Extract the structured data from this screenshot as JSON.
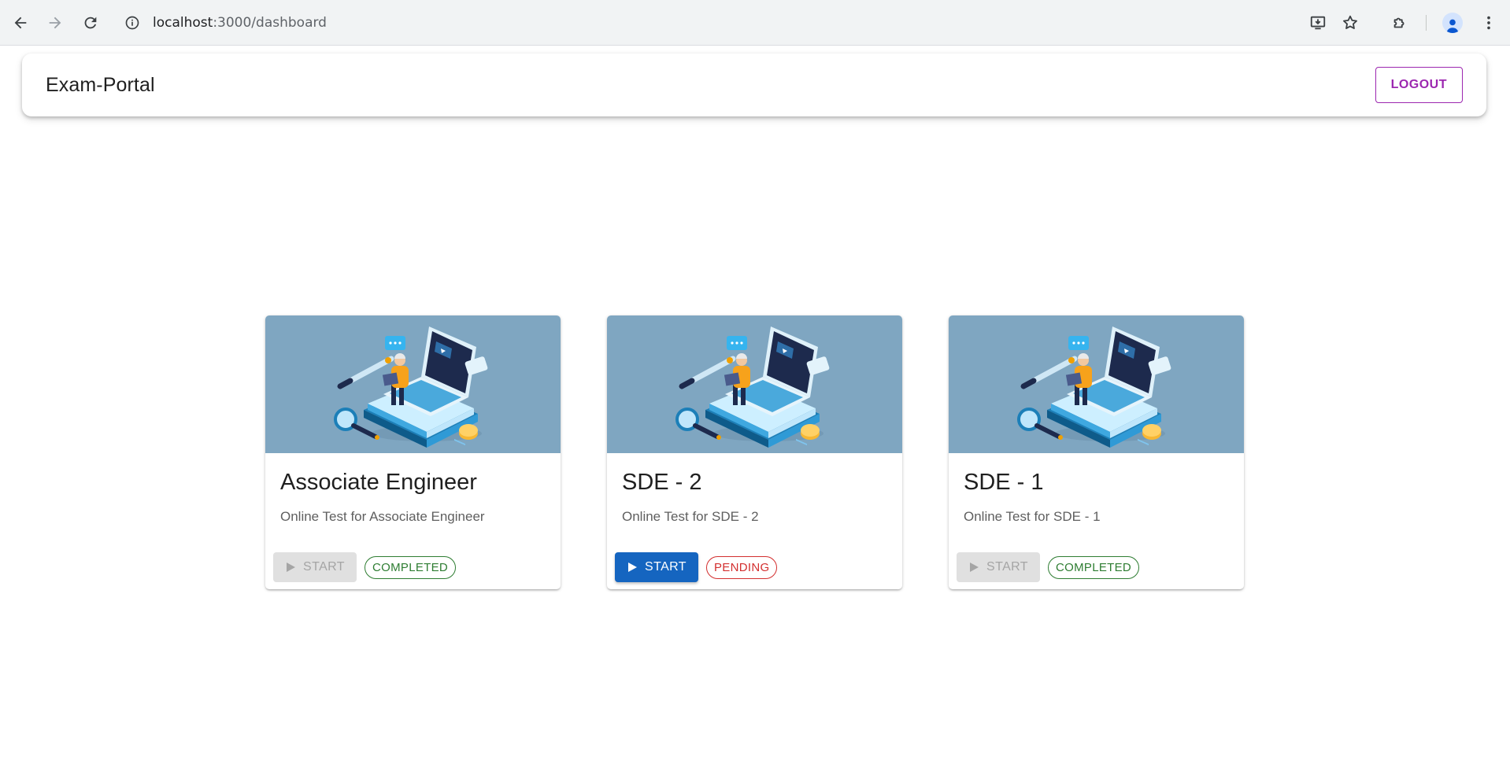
{
  "browser": {
    "url_host": "localhost",
    "url_path": ":3000/dashboard"
  },
  "app": {
    "title": "Exam-Portal",
    "logout_label": "LOGOUT"
  },
  "cards": [
    {
      "title": "Associate Engineer",
      "description": "Online Test for Associate Engineer",
      "start_label": "START",
      "start_enabled": false,
      "status": "COMPLETED"
    },
    {
      "title": "SDE - 2",
      "description": "Online Test for SDE - 2",
      "start_label": "START",
      "start_enabled": true,
      "status": "PENDING"
    },
    {
      "title": "SDE - 1",
      "description": "Online Test for SDE - 1",
      "start_label": "START",
      "start_enabled": false,
      "status": "COMPLETED"
    }
  ],
  "colors": {
    "primary": "#1565c0",
    "secondary": "#9c27b0",
    "success": "#2e7d32",
    "error": "#d32f2f",
    "media_bg": "#7fa6c1"
  }
}
